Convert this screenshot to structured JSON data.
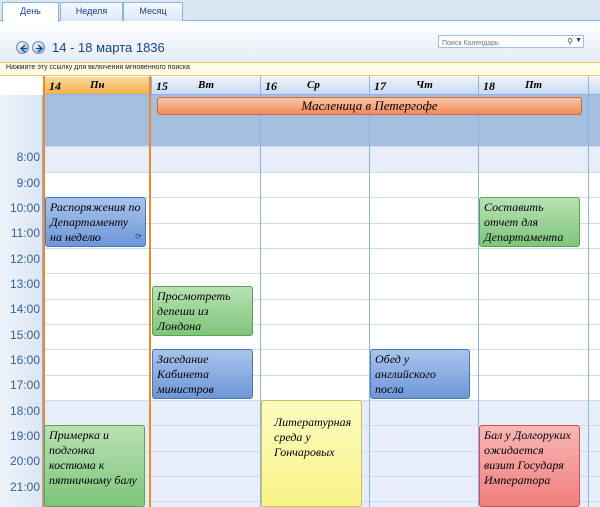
{
  "tabs": [
    {
      "label": "День",
      "active": true
    },
    {
      "label": "Неделя",
      "active": false
    },
    {
      "label": "Месяц",
      "active": false
    }
  ],
  "header": {
    "range": "14 - 18 марта 1836",
    "search_placeholder": "Поиск Календарь"
  },
  "infobar": {
    "text": "Нажмите эту ссылку для включения мгновенного поиска"
  },
  "days": [
    {
      "num": "14",
      "weekday": "Пн",
      "today": true
    },
    {
      "num": "15",
      "weekday": "Вт",
      "today": false
    },
    {
      "num": "16",
      "weekday": "Ср",
      "today": false
    },
    {
      "num": "17",
      "weekday": "Чт",
      "today": false
    },
    {
      "num": "18",
      "weekday": "Пт",
      "today": false
    }
  ],
  "allday_event": "Масленица в Петергофе",
  "times": [
    "8:00",
    "9:00",
    "10:00",
    "11:00",
    "12:00",
    "13:00",
    "14:00",
    "15:00",
    "16:00",
    "17:00",
    "18:00",
    "19:00",
    "20:00",
    "21:00"
  ],
  "appointments": [
    {
      "text": "Распоряжения по Департаменту на неделю",
      "color": "blue"
    },
    {
      "text": "Составить отчет для Департамента",
      "color": "green"
    },
    {
      "text": "Просмотреть депеши из Лондона",
      "color": "green"
    },
    {
      "text": "Заседание Кабинета министров",
      "color": "blue"
    },
    {
      "text": "Обед у английского посла",
      "color": "blue"
    },
    {
      "text": "Литературная среда у Гончаровых",
      "color": "yellow"
    },
    {
      "text": "Примерка и подгонка костюма к пятничному балу",
      "color": "green"
    },
    {
      "text": "Бал у Долгоруких ожидается визит Государя Императора",
      "color": "red"
    }
  ],
  "icons": {
    "back": "arrow-left-icon",
    "forward": "arrow-right-icon",
    "search": "search-icon",
    "recurrence": "recurrence-icon"
  }
}
